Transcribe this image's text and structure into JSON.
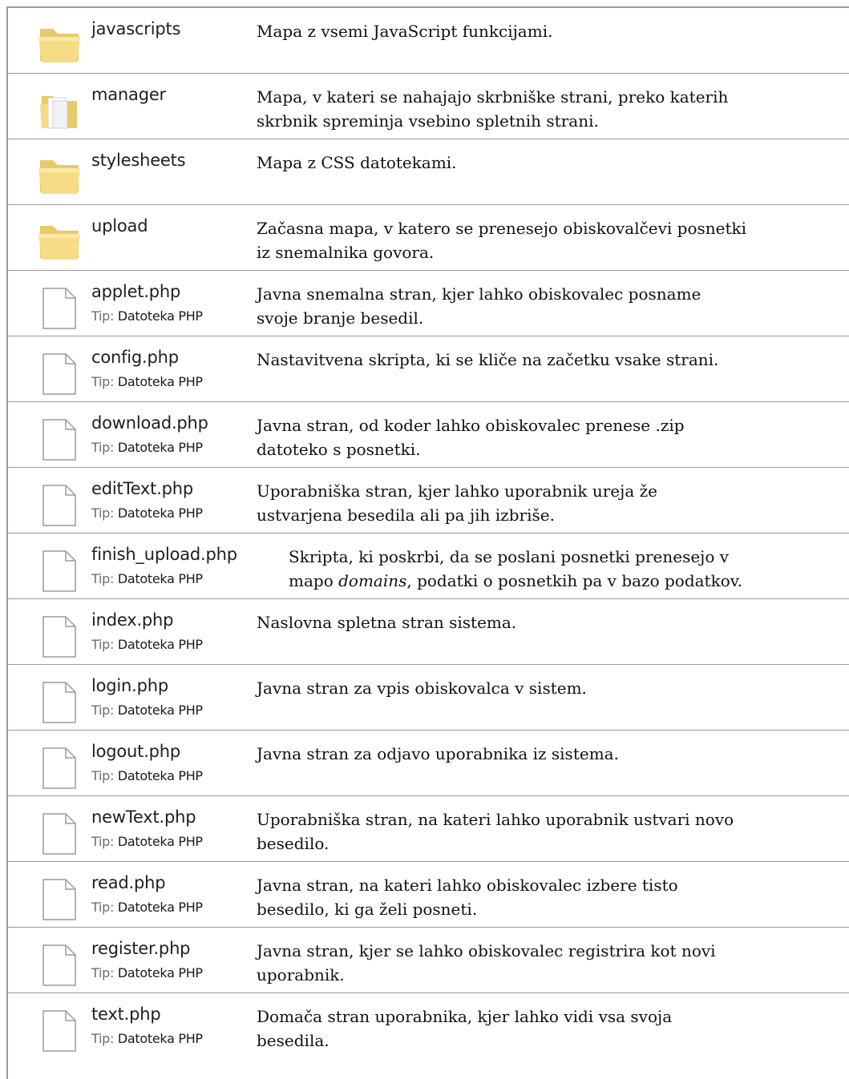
{
  "type_label": "Tip:",
  "rows": [
    {
      "name": "javascripts",
      "icon": "folder-icon",
      "description": [
        "Mapa z vsemi JavaScript funkcijami."
      ]
    },
    {
      "name": "manager",
      "icon": "folder-open-icon",
      "description": [
        "Mapa, v kateri se nahajajo skrbniške  strani, preko katerih",
        "skrbnik spreminja vsebino spletnih strani."
      ]
    },
    {
      "name": "stylesheets",
      "icon": "folder-icon",
      "description": [
        "Mapa z CSS datotekami."
      ]
    },
    {
      "name": "upload",
      "icon": "folder-icon",
      "description": [
        "Začasna mapa, v katero se prenesejo obiskovalčevi posnetki",
        "iz snemalnika govora."
      ]
    },
    {
      "name": "applet.php",
      "icon": "file-icon",
      "type": "Datoteka PHP",
      "description": [
        "Javna snemalna  stran, kjer lahko obiskovalec posname",
        "svoje branje besedil."
      ]
    },
    {
      "name": "config.php",
      "icon": "file-icon",
      "type": "Datoteka PHP",
      "description": [
        "Nastavitvena skripta, ki se kliče na začetku vsake strani."
      ]
    },
    {
      "name": "download.php",
      "icon": "file-icon",
      "type": "Datoteka PHP",
      "description": [
        "Javna stran, od koder lahko obiskovalec prenese .zip",
        "datoteko s posnetki."
      ]
    },
    {
      "name": "editText.php",
      "icon": "file-icon",
      "type": "Datoteka PHP",
      "description": [
        "Uporabniška stran, kjer lahko uporabnik ureja že",
        "ustvarjena besedila ali pa jih izbriše."
      ]
    },
    {
      "name": "finish_upload.php",
      "icon": "file-icon",
      "type": "Datoteka PHP",
      "description_parts": {
        "line1": "Skripta, ki poskrbi, da se poslani posnetki prenesejo v",
        "line2_a": "mapo ",
        "line2_em": "domains",
        "line2_b": ", podatki o posnetkih pa v bazo podatkov."
      }
    },
    {
      "name": "index.php",
      "icon": "file-icon",
      "type": "Datoteka PHP",
      "description": [
        "Naslovna spletna stran sistema."
      ]
    },
    {
      "name": "login.php",
      "icon": "file-icon",
      "type": "Datoteka PHP",
      "description": [
        "Javna stran za vpis obiskovalca v sistem."
      ]
    },
    {
      "name": "logout.php",
      "icon": "file-icon",
      "type": "Datoteka PHP",
      "description": [
        "Javna stran za odjavo uporabnika iz sistema."
      ]
    },
    {
      "name": "newText.php",
      "icon": "file-icon",
      "type": "Datoteka PHP",
      "description": [
        "Uporabniška stran, na kateri lahko uporabnik ustvari novo",
        "besedilo."
      ]
    },
    {
      "name": "read.php",
      "icon": "file-icon",
      "type": "Datoteka PHP",
      "description": [
        "Javna stran, na kateri lahko obiskovalec izbere tisto",
        "besedilo, ki ga želi posneti."
      ]
    },
    {
      "name": "register.php",
      "icon": "file-icon",
      "type": "Datoteka PHP",
      "description": [
        "Javna stran, kjer se lahko obiskovalec registrira kot novi",
        "uporabnik."
      ]
    },
    {
      "name": "text.php",
      "icon": "file-icon",
      "type": "Datoteka PHP",
      "description": [
        "Domača stran uporabnika, kjer lahko vidi vsa svoja",
        "besedila."
      ]
    }
  ]
}
